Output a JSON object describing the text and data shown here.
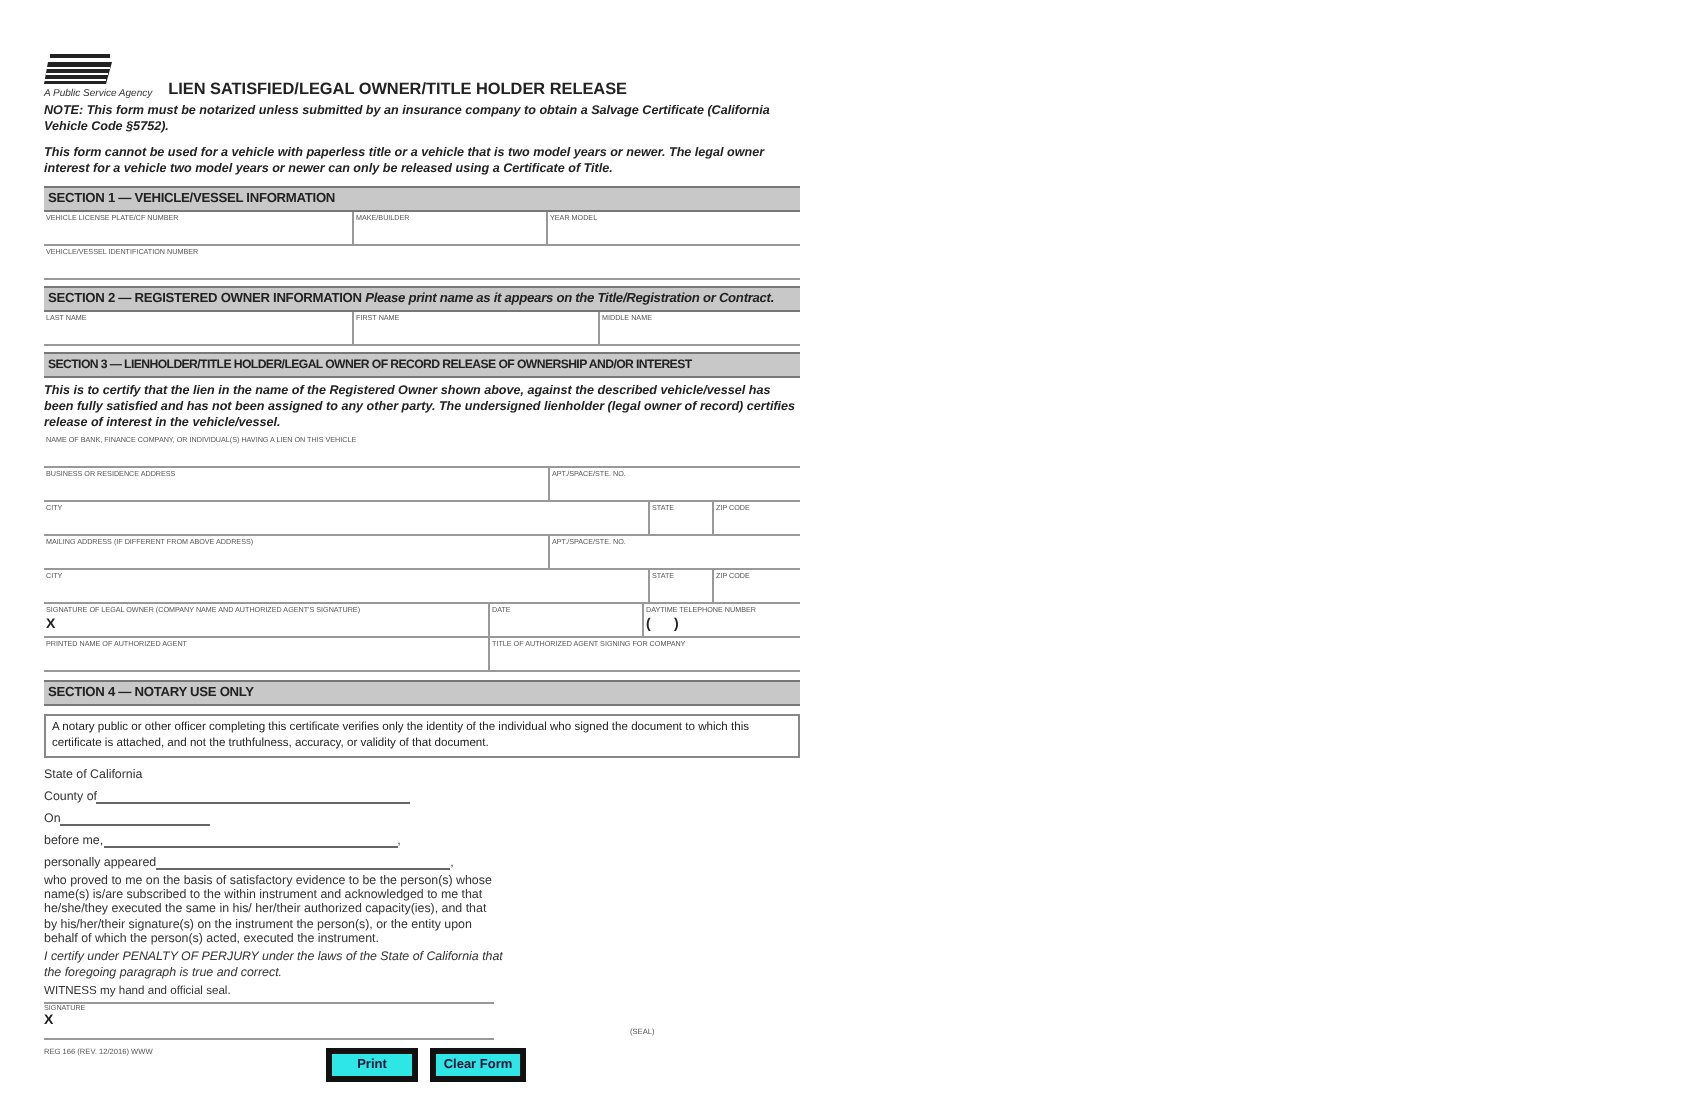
{
  "header": {
    "agency": "A Public Service Agency",
    "title": "LIEN SATISFIED/LEGAL OWNER/TITLE HOLDER RELEASE"
  },
  "notes": [
    "NOTE: This form must be notarized unless submitted by an insurance company to obtain a Salvage Certificate (California Vehicle Code §5752).",
    "This form cannot be used for a vehicle with paperless title or a vehicle that is two model years or newer. The legal owner interest for a vehicle two model years or newer can only be released using a Certificate of Title."
  ],
  "sections": [
    {
      "heading": "SECTION 1 — VEHICLE/VESSEL INFORMATION",
      "rows": [
        [
          {
            "label": "VEHICLE LICENSE PLATE/CF NUMBER"
          },
          {
            "label": "MAKE/BUILDER"
          },
          {
            "label": "YEAR MODEL"
          }
        ],
        [
          {
            "label": "VEHICLE/VESSEL IDENTIFICATION NUMBER"
          }
        ]
      ]
    },
    {
      "heading": "SECTION 2 — REGISTERED OWNER INFORMATION *Please print name as it appears on the Title/Registration or Contract.*",
      "rows": [
        [
          {
            "label": "LAST NAME"
          },
          {
            "label": "FIRST NAME"
          },
          {
            "label": "MIDDLE NAME"
          }
        ]
      ]
    },
    {
      "heading": "SECTION 3 — LIENHOLDER/TITLE HOLDER/LEGAL OWNER OF RECORD RELEASE OF OWNERSHIP AND/OR INTEREST",
      "intro": "This is to certify that the lien in the name of the Registered Owner shown above, against the described vehicle/vessel has been fully satisfied and has not been assigned to any other party. The undersigned lienholder (legal owner of record) certifies release of interest in the vehicle/vessel.",
      "rows": [
        [
          {
            "label": "NAME OF BANK, FINANCE COMPANY, OR INDIVIDUAL(S) HAVING A LIEN ON THIS VEHICLE"
          }
        ],
        [
          {
            "label": "BUSINESS OR RESIDENCE ADDRESS"
          },
          {
            "label": "APT./SPACE/STE. NO."
          }
        ],
        [
          {
            "label": "CITY"
          },
          {
            "label": "STATE"
          },
          {
            "label": "ZIP CODE"
          }
        ],
        [
          {
            "label": "MAILING ADDRESS (IF DIFFERENT FROM ABOVE ADDRESS)"
          },
          {
            "label": "APT./SPACE/STE. NO."
          }
        ],
        [
          {
            "label": "CITY"
          },
          {
            "label": "STATE"
          },
          {
            "label": "ZIP CODE"
          }
        ],
        [
          {
            "label": "SIGNATURE OF LEGAL OWNER (COMPANY NAME AND AUTHORIZED AGENT'S SIGNATURE)",
            "mark": "X"
          },
          {
            "label": "DATE"
          },
          {
            "label": "DAYTIME TELEPHONE NUMBER",
            "mark": "(      )"
          }
        ],
        [
          {
            "label": "PRINTED NAME OF AUTHORIZED AGENT"
          },
          {
            "label": "TITLE OF AUTHORIZED AGENT SIGNING FOR COMPANY"
          }
        ]
      ]
    }
  ],
  "notary": {
    "heading": "SECTION 4 — NOTARY USE ONLY",
    "notice": "A notary public or other officer completing this certificate verifies only the identity of the individual who signed the document to which this certificate is attached, and not the truthfulness, accuracy, or validity of that document.",
    "state": "State of California",
    "lines": [
      {
        "label": "County of"
      },
      {
        "label": "On"
      },
      {
        "label": "before me,",
        "trail": ","
      },
      {
        "label": "personally appeared",
        "trail": ","
      }
    ],
    "statement": "who proved to me on the basis of satisfactory evidence to be the person(s) whose name(s) is/are subscribed to the within instrument and acknowledged to me that he/she/they executed the same in his/ her/their authorized capacity(ies), and that by his/her/their signature(s) on the instrument the person(s), or the entity upon behalf of which the person(s) acted, executed the instrument.",
    "certify": "I certify under PENALTY OF PERJURY under the laws of the State of California that the foregoing paragraph is true and correct.",
    "witness": "WITNESS my hand and official seal.",
    "signature_label": "SIGNATURE",
    "signature_mark": "X",
    "seal": "(SEAL)"
  },
  "footer": {
    "form_id": "REG 166 (REV. 12/2016) WWW"
  },
  "buttons": [
    "Print",
    "Clear Form"
  ]
}
